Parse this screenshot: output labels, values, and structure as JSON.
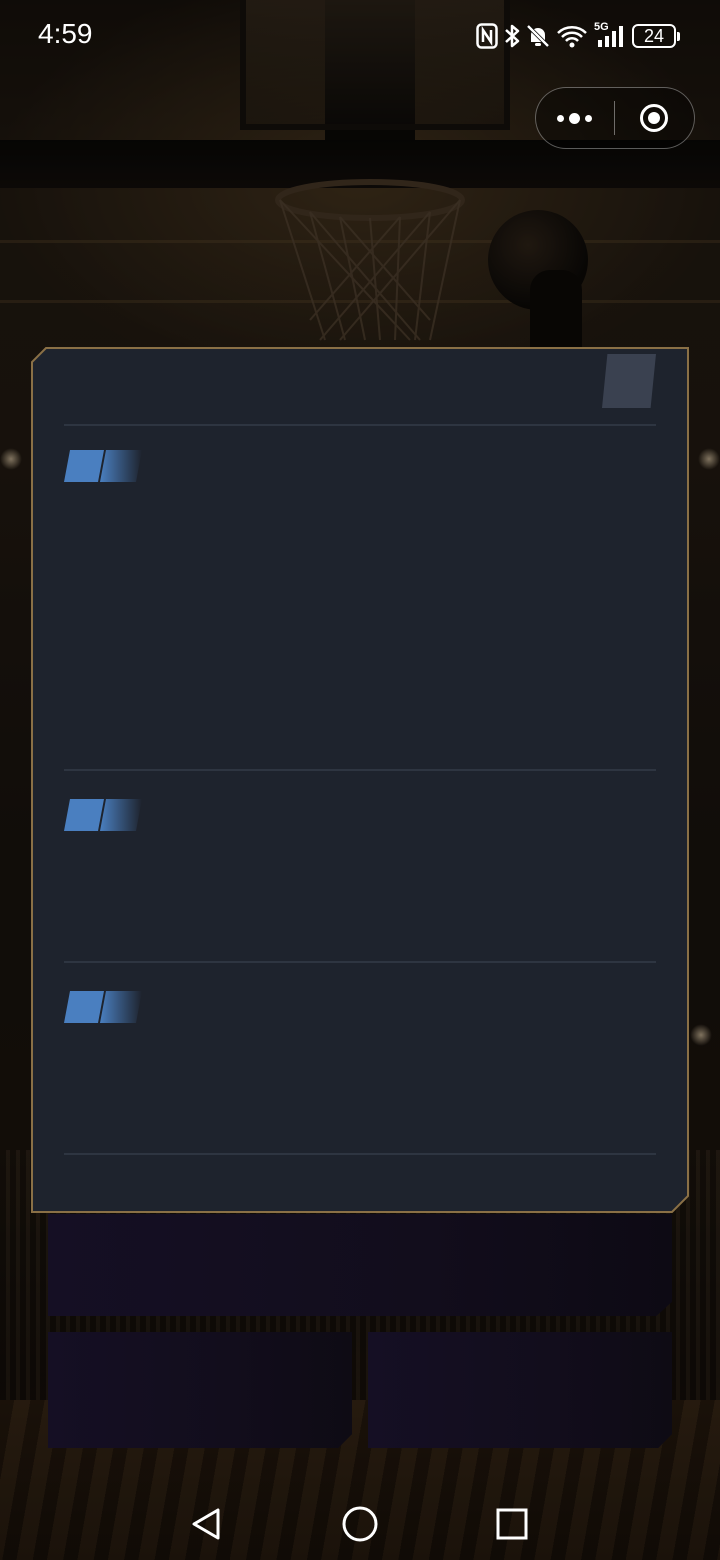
{
  "status_bar": {
    "time": "4:59",
    "battery_level": "24",
    "network_label": "5G",
    "icons": [
      "nfc-icon",
      "bluetooth-icon",
      "mute-bell-icon",
      "wifi-icon",
      "cellular-signal-icon",
      "battery-icon"
    ]
  },
  "capsule": {
    "icons": [
      "more-dots-icon",
      "close-target-icon"
    ]
  },
  "panel": {
    "close_icon": "close-icon",
    "sections": [
      {
        "title": ""
      },
      {
        "title": ""
      },
      {
        "title": ""
      }
    ]
  },
  "buttons": {
    "primary_label": "",
    "left_label": "",
    "right_label": ""
  },
  "nav_bar": {
    "icons": [
      "back-icon",
      "home-icon",
      "recents-icon"
    ]
  },
  "colors": {
    "panel_bg": "#1e232d",
    "panel_border": "#8a7046",
    "divider": "#2e3541",
    "accent_blue": "#4a7fc0",
    "button_bg": "#140f20"
  }
}
